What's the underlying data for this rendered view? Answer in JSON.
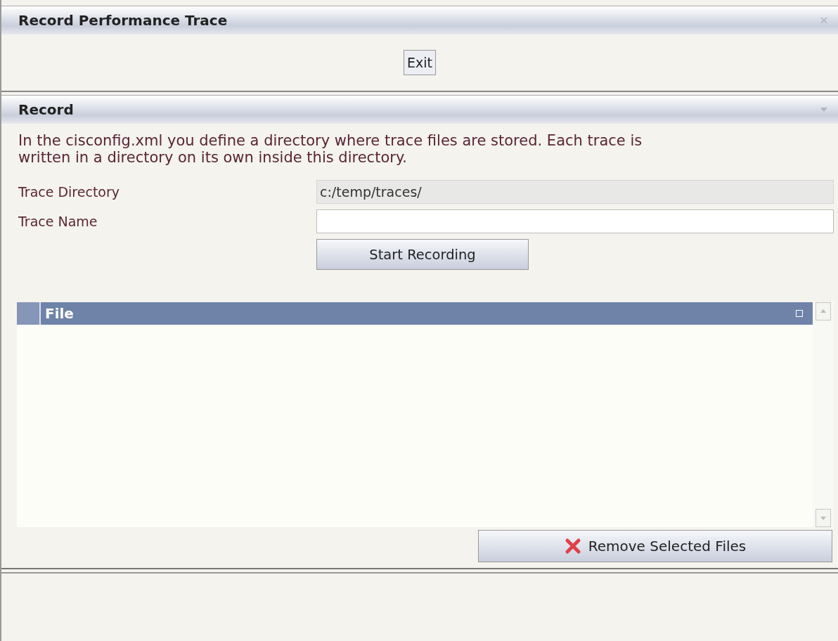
{
  "window": {
    "title": "Record Performance Trace"
  },
  "toolbar": {
    "exit_button": "Exit"
  },
  "section": {
    "title": "Record",
    "expanded": true,
    "description": "In the cisconfig.xml you define a directory where trace files are stored. Each trace is written in a directory on its own inside this directory.",
    "fields": [
      {
        "label": "Trace Directory",
        "value": "c:/temp/traces/",
        "disabled": true
      },
      {
        "label": "Trace Name",
        "disabled": false
      }
    ],
    "start_button": "Start Recording"
  },
  "table": {
    "columns": [
      "File"
    ]
  },
  "remove_button": "Remove Selected Files"
}
